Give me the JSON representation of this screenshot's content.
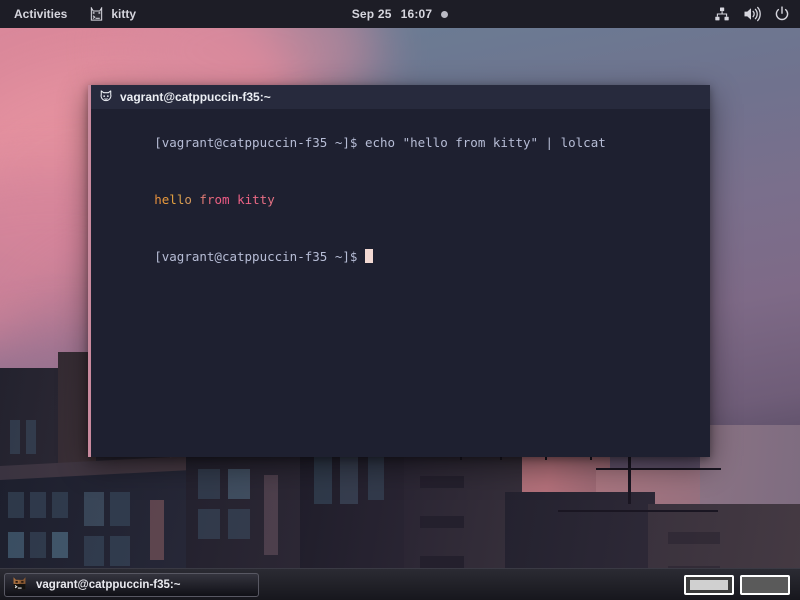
{
  "topbar": {
    "activities_label": "Activities",
    "app_icon": "kitty-icon",
    "app_label": "kitty",
    "date": "Sep 25",
    "time": "16:07",
    "notification_dot": "notification-indicator",
    "status_icons": [
      "network-icon",
      "volume-icon",
      "power-icon"
    ]
  },
  "terminal": {
    "icon": "cat-icon",
    "title": "vagrant@catppuccin-f35:~",
    "lines": [
      {
        "prompt": "[vagrant@catppuccin-f35 ~]$ ",
        "command": "echo \"hello from kitty\" | lolcat"
      },
      {
        "output": "hello from kitty"
      },
      {
        "prompt": "[vagrant@catppuccin-f35 ~]$ ",
        "command": ""
      }
    ],
    "lolcat_colors": [
      "#e8913d",
      "#e99a3c",
      "#e3a03f",
      "#dba24a",
      "#d2975c",
      "#d88a6b",
      "#e07a74",
      "#e56c7a",
      "#ec6182",
      "#ef5a86",
      "#ee5d86",
      "#ed6186",
      "#ec6585",
      "#ea6984",
      "#e76d84",
      "#e47183"
    ],
    "colors": {
      "background": "#1e2030",
      "titlebar": "#272a3d",
      "border_accent": "#c98a9e",
      "prompt_text": "#b7bdd6",
      "cursor": "#f2d9d3"
    }
  },
  "taskbar": {
    "window_icon": "kitty-icon",
    "window_title": "vagrant@catppuccin-f35:~",
    "workspaces": [
      {
        "name": "workspace-1",
        "active": true
      },
      {
        "name": "workspace-2",
        "active": false
      }
    ]
  }
}
